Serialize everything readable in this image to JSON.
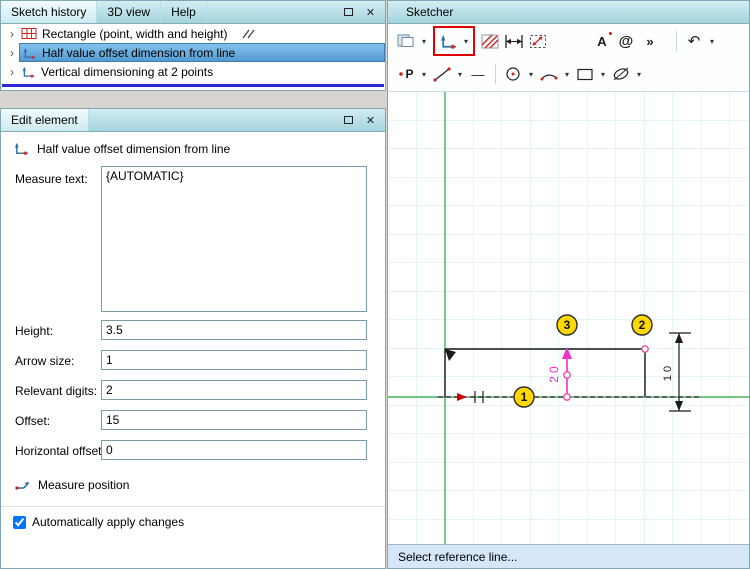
{
  "glyphs": {
    "expander": "›",
    "dropdown": "▾",
    "close": "✕"
  },
  "colors": {
    "highlight_red": "#e10000",
    "selection_blue": "#559ad0",
    "dimension_magenta": "#ee2fd2",
    "balloon_yellow": "#ffd800",
    "axis_green": "#1fa838"
  },
  "sketch_history": {
    "tabs": [
      {
        "label": "Sketch history"
      },
      {
        "label": "3D view"
      },
      {
        "label": "Help"
      }
    ],
    "items": [
      {
        "label": "Rectangle (point, width and height)"
      },
      {
        "label": "Half value offset dimension from line"
      },
      {
        "label": "Vertical dimensioning at 2 points"
      }
    ]
  },
  "edit_element": {
    "title": "Edit element",
    "element_name": "Half value offset dimension from line",
    "measure_text_label": "Measure text:",
    "measure_text_value": "{AUTOMATIC}",
    "fields": [
      {
        "label": "Height:",
        "value": "3.5"
      },
      {
        "label": "Arrow size:",
        "value": "1"
      },
      {
        "label": "Relevant digits:",
        "value": "2"
      },
      {
        "label": "Offset:",
        "value": "15"
      },
      {
        "label": "Horizontal offset:",
        "value": "0"
      }
    ],
    "measure_position_label": "Measure position",
    "auto_apply_label": "Automatically apply changes",
    "auto_apply_checked": true
  },
  "sketcher": {
    "title": "Sketcher",
    "status": "Select reference line...",
    "toolbar": {
      "text_tool": "A",
      "at_tool": "@",
      "more": "»",
      "undo": "↶",
      "point": "P",
      "hline": "—"
    },
    "canvas": {
      "dim_offset": "20",
      "dim_vertical": "10",
      "balloons": [
        "1",
        "2",
        "3"
      ]
    }
  }
}
